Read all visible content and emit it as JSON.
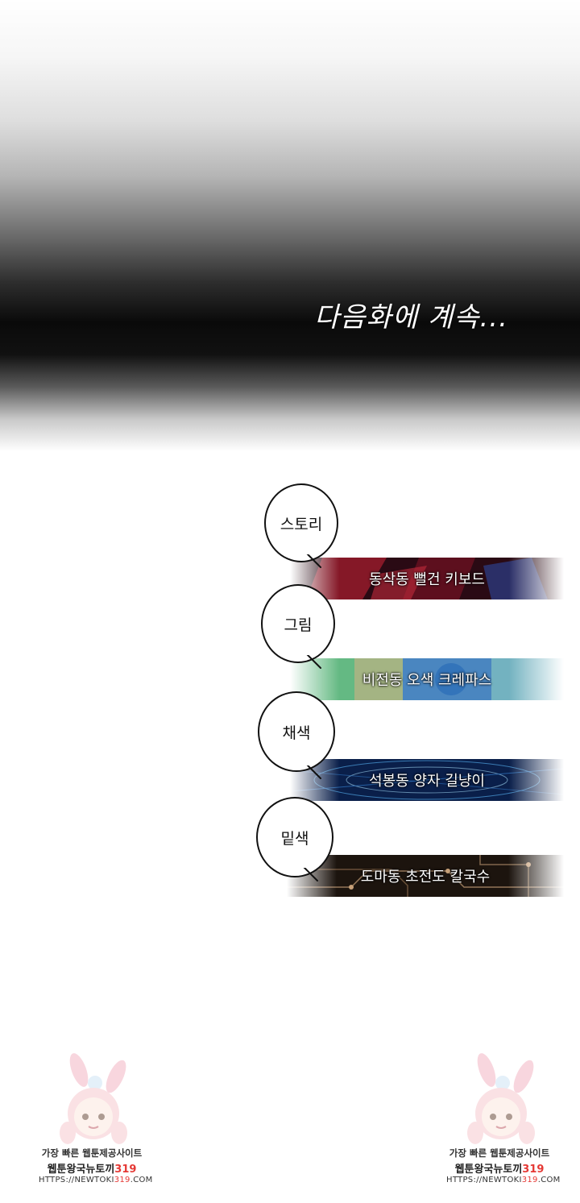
{
  "continue_text": "다음화에 계속...",
  "credits": [
    {
      "role": "스토리",
      "name": "동삭동 뻘건 키보드",
      "colors": [
        "#3a0c18",
        "#9c1c2c",
        "#2c3f8a"
      ]
    },
    {
      "role": "그림",
      "name": "비전동 오색 크레파스",
      "colors": [
        "#3f8ed0",
        "#6fcf6a",
        "#e1d35a"
      ]
    },
    {
      "role": "채색",
      "name": "석봉동 양자 길냥이",
      "colors": [
        "#0a1f4a",
        "#2d6fb8",
        "#9fd3f0"
      ]
    },
    {
      "role": "밑색",
      "name": "도마동 초전도 칼국수",
      "colors": [
        "#1c140e",
        "#5a3f2a",
        "#c7a078"
      ]
    }
  ],
  "watermark": {
    "line1": "가장 빠른 웹툰제공사이트",
    "line2_main": "웹툰왕국뉴토끼",
    "line2_num": "319",
    "line3_pre": "HTTPS://NEWTOKI",
    "line3_num": "319",
    "line3_post": ".COM"
  }
}
